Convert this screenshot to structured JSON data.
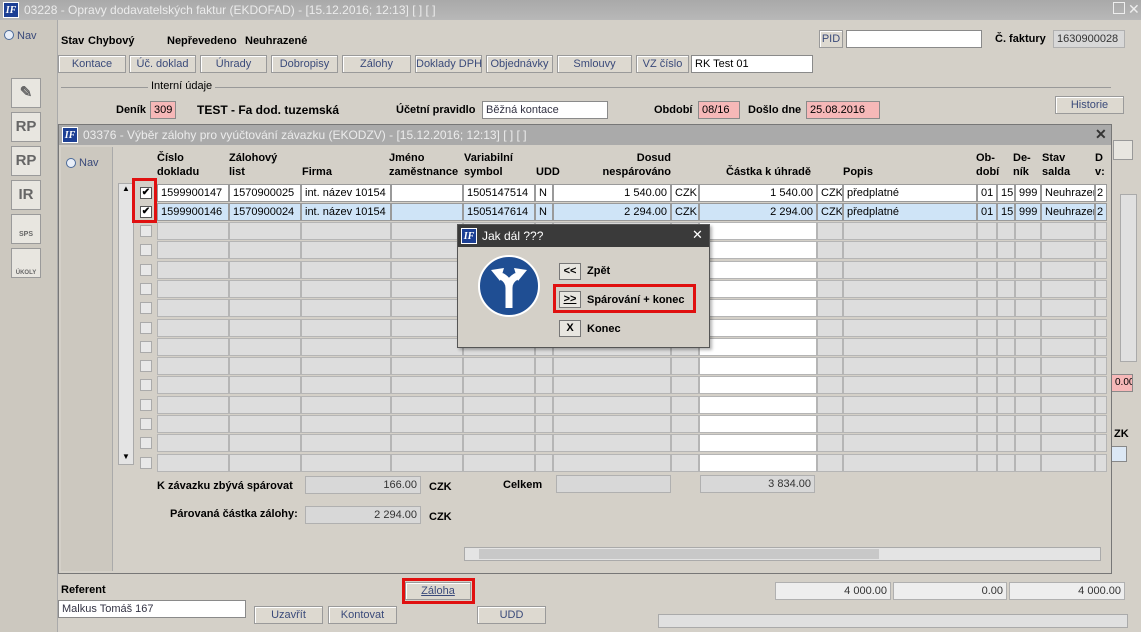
{
  "main": {
    "title": "03228 - Opravy dodavatelských faktur (EKDOFAD) - [15.12.2016; 12:13]  [ ]  [ ]",
    "nav": "Nav",
    "stav_label": "Stav",
    "stav_value": "Chybový",
    "neprevedeno": "Nepřevedeno",
    "neuhrazene": "Neuhrazené",
    "pid_label": "PID",
    "pid_value": "",
    "cislo_faktury_label": "Č. faktury",
    "cislo_faktury_value": "1630900028",
    "buttons": [
      "Kontace",
      "Úč. doklad",
      "Úhrady",
      "Dobropisy",
      "Zálohy",
      "Doklady DPH",
      "Objednávky",
      "Smlouvy",
      "VZ číslo"
    ],
    "vz_value": "RK Test 01",
    "interni_udaje": "Interní údaje",
    "denik_label": "Deník",
    "denik_value": "309",
    "denik_name": "TEST - Fa dod. tuzemská",
    "ucetni_pravidlo_label": "Účetní pravidlo",
    "ucetni_pravidlo_value": "Běžná kontace",
    "obdobi_label": "Období",
    "obdobi_value": "08/16",
    "doslo_label": "Došlo dne",
    "doslo_value": "25.08.2016",
    "historie": "Historie",
    "side_icons": [
      "pen-icon",
      "RP",
      "RP",
      "IR",
      "SPS",
      "ÚKOLY"
    ],
    "referent_label": "Referent",
    "referent_value": "Malkus Tomáš 167",
    "zaloha_btn": "Záloha",
    "uzavrit_btn": "Uzavřít",
    "kontovat_btn": "Kontovat",
    "udd_btn": "UDD",
    "bottom_amounts": [
      "4 000.00",
      "0.00",
      "4 000.00"
    ],
    "right_edge": [
      "0.00",
      "ZK"
    ]
  },
  "subwindow": {
    "title": "03376 - Výběr zálohy pro vyúčtování závazku (EKODZV) - [15.12.2016; 12:13]  [ ]  [ ]",
    "nav": "Nav",
    "headers": {
      "cislo_dokladu": "Číslo dokladu",
      "zalohovy_list": "Zálohový list",
      "firma": "Firma",
      "jmeno": "Jméno zaměstnance",
      "variabilni": "Variabilní symbol",
      "udd": "UDD",
      "dosud": "Dosud nespárováno",
      "castka": "Částka k úhradě",
      "popis": "Popis",
      "obdobi": "Ob- dobí",
      "denik": "De- ník",
      "stav_salda": "Stav salda",
      "d": "D v:"
    },
    "rows": [
      {
        "checked": "✔",
        "cislo": "1599900147",
        "zalohovy": "1570900025",
        "firma": "int. název 10154",
        "jmeno": "",
        "vs": "1505147514",
        "udd": "N",
        "dosud": "1 540.00",
        "mena1": "CZK",
        "castka": "1 540.00",
        "mena2": "CZK",
        "popis": "předplatné",
        "obd": "01",
        "obd2": "15",
        "denik": "999",
        "stav": "Neuhrazen",
        "d": "2"
      },
      {
        "checked": "✔",
        "cislo": "1599900146",
        "zalohovy": "1570900024",
        "firma": "int. název 10154",
        "jmeno": "",
        "vs": "1505147614",
        "udd": "N",
        "dosud": "2 294.00",
        "mena1": "CZK",
        "castka": "2 294.00",
        "mena2": "CZK",
        "popis": "předplatné",
        "obd": "01",
        "obd2": "15",
        "denik": "999",
        "stav": "Neuhrazen",
        "d": "2"
      }
    ],
    "zbyva_label": "K závazku zbývá spárovat",
    "zbyva_value": "166.00",
    "zbyva_mena": "CZK",
    "celkem_label": "Celkem",
    "celkem_value": "3 834.00",
    "parovana_label": "Párovaná částka zálohy:",
    "parovana_value": "2 294.00",
    "parovana_mena": "CZK"
  },
  "dialog": {
    "title": "Jak dál ???",
    "zpet_btn": "<<",
    "zpet_label": "Zpět",
    "parovani_btn": ">>",
    "parovani_label": "Spárování + konec",
    "konec_btn": "X",
    "konec_label": "Konec"
  }
}
